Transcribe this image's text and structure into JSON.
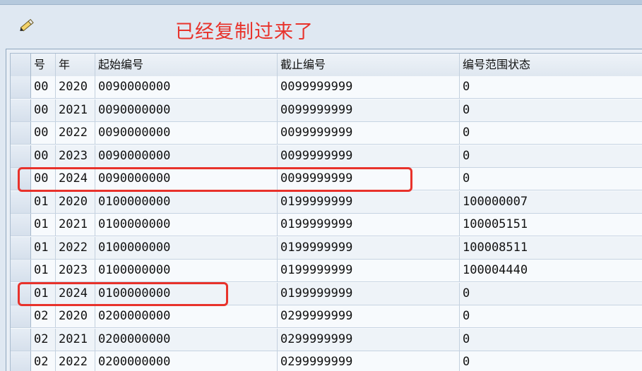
{
  "toolbar": {
    "edit_icon": "pencil-eraser-icon",
    "annotation": "已经复制过来了",
    "annotation_color": "#e8322b"
  },
  "table": {
    "headers": [
      "号",
      "年",
      "起始编号",
      "截止编号",
      "编号范围状态"
    ],
    "rows": [
      [
        "00",
        "2020",
        "0090000000",
        "0099999999",
        "0"
      ],
      [
        "00",
        "2021",
        "0090000000",
        "0099999999",
        "0"
      ],
      [
        "00",
        "2022",
        "0090000000",
        "0099999999",
        "0"
      ],
      [
        "00",
        "2023",
        "0090000000",
        "0099999999",
        "0"
      ],
      [
        "00",
        "2024",
        "0090000000",
        "0099999999",
        "0"
      ],
      [
        "01",
        "2020",
        "0100000000",
        "0199999999",
        "100000007"
      ],
      [
        "01",
        "2021",
        "0100000000",
        "0199999999",
        "100005151"
      ],
      [
        "01",
        "2022",
        "0100000000",
        "0199999999",
        "100008511"
      ],
      [
        "01",
        "2023",
        "0100000000",
        "0199999999",
        "100004440"
      ],
      [
        "01",
        "2024",
        "0100000000",
        "0199999999",
        "0"
      ],
      [
        "02",
        "2020",
        "0200000000",
        "0299999999",
        "0"
      ],
      [
        "02",
        "2021",
        "0200000000",
        "0299999999",
        "0"
      ],
      [
        "02",
        "2022",
        "0200000000",
        "0299999999",
        "0"
      ]
    ]
  }
}
